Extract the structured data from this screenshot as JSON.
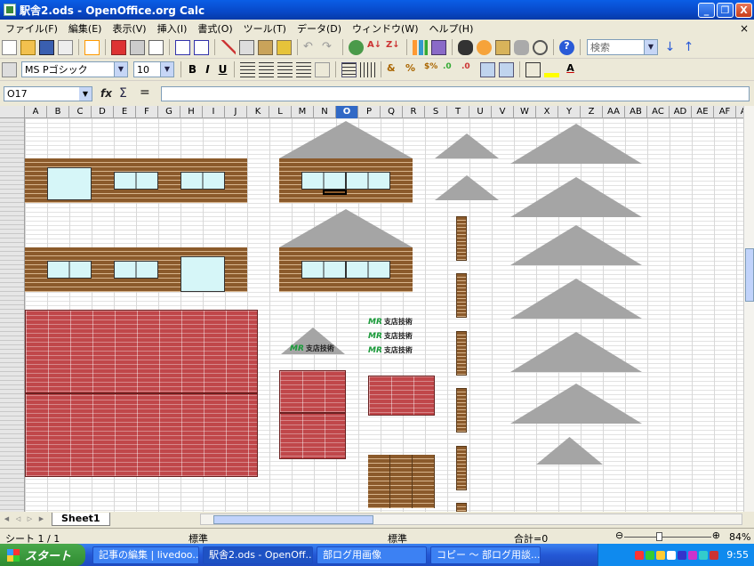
{
  "window": {
    "title": "駅舎2.ods - OpenOffice.org Calc",
    "min": "_",
    "max": "❐",
    "close": "X"
  },
  "menu": {
    "items": [
      "ファイル(F)",
      "編集(E)",
      "表示(V)",
      "挿入(I)",
      "書式(O)",
      "ツール(T)",
      "データ(D)",
      "ウィンドウ(W)",
      "ヘルプ(H)"
    ],
    "close": "×"
  },
  "toolbar": {
    "search_placeholder": "検索",
    "font_name": "MS Pゴシック",
    "font_size": "10",
    "bold": "B",
    "italic": "I",
    "underline": "U"
  },
  "formula": {
    "cell_ref": "O17",
    "fx": "fx",
    "sigma": "Σ",
    "equals": "="
  },
  "columns": [
    "A",
    "B",
    "C",
    "D",
    "E",
    "F",
    "G",
    "H",
    "I",
    "J",
    "K",
    "L",
    "M",
    "N",
    "O",
    "P",
    "Q",
    "R",
    "S",
    "T",
    "U",
    "V",
    "W",
    "X",
    "Y",
    "Z",
    "AA",
    "AB",
    "AC",
    "AD",
    "AE",
    "AF",
    "AG"
  ],
  "selected_column": "O",
  "sheet": {
    "tab": "Sheet1"
  },
  "status": {
    "sheet_pos": "シート 1 / 1",
    "style": "標準",
    "mode": "標準",
    "sum": "合計=0",
    "zoom": "84%"
  },
  "logo_text": "支店技術",
  "taskbar": {
    "start": "スタート",
    "tasks": [
      "記事の編集 | livedoo...",
      "駅舎2.ods - OpenOff...",
      "部ログ用画像",
      "コピー ～ 部ログ用談..."
    ],
    "clock": "9:55"
  }
}
